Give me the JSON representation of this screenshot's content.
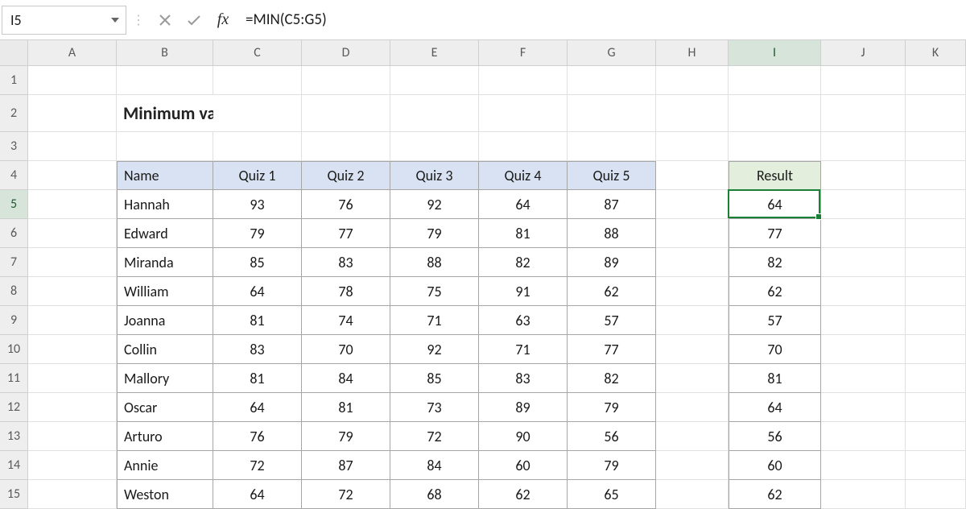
{
  "namebox": {
    "value": "I5"
  },
  "formula": "=MIN(C5:G5)",
  "columns": [
    "A",
    "B",
    "C",
    "D",
    "E",
    "F",
    "G",
    "H",
    "I",
    "J",
    "K"
  ],
  "active_col": "I",
  "active_row": 5,
  "title": "Minimum value",
  "table": {
    "headers": [
      "Name",
      "Quiz 1",
      "Quiz 2",
      "Quiz 3",
      "Quiz 4",
      "Quiz 5"
    ],
    "result_header": "Result",
    "rows": [
      {
        "name": "Hannah",
        "q": [
          93,
          76,
          92,
          64,
          87
        ],
        "result": 64
      },
      {
        "name": "Edward",
        "q": [
          79,
          77,
          79,
          81,
          88
        ],
        "result": 77
      },
      {
        "name": "Miranda",
        "q": [
          85,
          83,
          88,
          82,
          89
        ],
        "result": 82
      },
      {
        "name": "William",
        "q": [
          64,
          78,
          75,
          91,
          62
        ],
        "result": 62
      },
      {
        "name": "Joanna",
        "q": [
          81,
          74,
          71,
          63,
          57
        ],
        "result": 57
      },
      {
        "name": "Collin",
        "q": [
          83,
          70,
          92,
          71,
          77
        ],
        "result": 70
      },
      {
        "name": "Mallory",
        "q": [
          81,
          84,
          85,
          83,
          82
        ],
        "result": 81
      },
      {
        "name": "Oscar",
        "q": [
          64,
          81,
          73,
          89,
          79
        ],
        "result": 64
      },
      {
        "name": "Arturo",
        "q": [
          76,
          79,
          72,
          90,
          56
        ],
        "result": 56
      },
      {
        "name": "Annie",
        "q": [
          72,
          87,
          84,
          60,
          79
        ],
        "result": 60
      },
      {
        "name": "Weston",
        "q": [
          64,
          72,
          68,
          62,
          65
        ],
        "result": 62
      }
    ]
  },
  "chart_data": {
    "type": "table",
    "title": "Minimum value",
    "columns": [
      "Name",
      "Quiz 1",
      "Quiz 2",
      "Quiz 3",
      "Quiz 4",
      "Quiz 5",
      "Result"
    ],
    "rows": [
      [
        "Hannah",
        93,
        76,
        92,
        64,
        87,
        64
      ],
      [
        "Edward",
        79,
        77,
        79,
        81,
        88,
        77
      ],
      [
        "Miranda",
        85,
        83,
        88,
        82,
        89,
        82
      ],
      [
        "William",
        64,
        78,
        75,
        91,
        62,
        62
      ],
      [
        "Joanna",
        81,
        74,
        71,
        63,
        57,
        57
      ],
      [
        "Collin",
        83,
        70,
        92,
        71,
        77,
        70
      ],
      [
        "Mallory",
        81,
        84,
        85,
        83,
        82,
        81
      ],
      [
        "Oscar",
        64,
        81,
        73,
        89,
        79,
        64
      ],
      [
        "Arturo",
        76,
        79,
        72,
        90,
        56,
        56
      ],
      [
        "Annie",
        72,
        87,
        84,
        60,
        79,
        60
      ],
      [
        "Weston",
        64,
        72,
        68,
        62,
        65,
        62
      ]
    ],
    "formula": "=MIN(C5:G5)"
  }
}
